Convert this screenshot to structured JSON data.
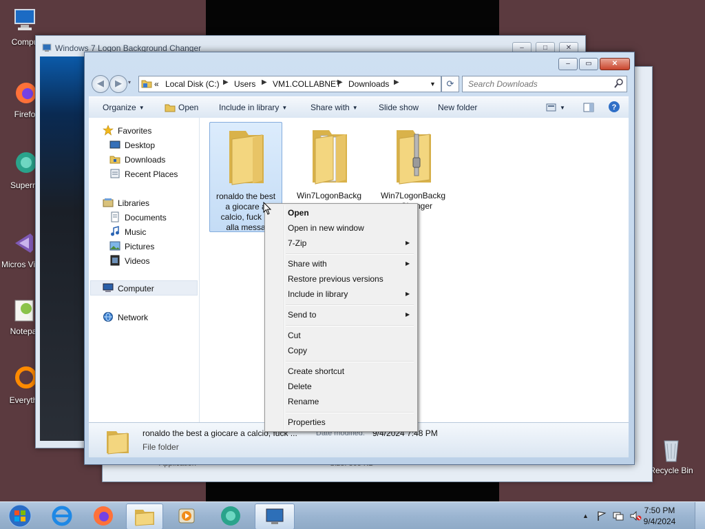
{
  "desktop": {
    "icons": [
      {
        "label": "Compu"
      },
      {
        "label": "Firefo"
      },
      {
        "label": "Superm"
      },
      {
        "label": "Micros Visual St"
      },
      {
        "label": "Notepa"
      },
      {
        "label": "Everyth"
      },
      {
        "label": "Recycle Bin"
      }
    ]
  },
  "bg_window": {
    "title": "Windows 7 Logon Background Changer"
  },
  "bg_window_right": {
    "partial_text_1": "Application",
    "partial_text_2": "Size: 365 KB"
  },
  "explorer": {
    "address": {
      "overflow": "«",
      "crumbs": [
        "Local Disk (C:)",
        "Users",
        "VM1.COLLABNET",
        "Downloads"
      ]
    },
    "search_placeholder": "Search Downloads",
    "toolbar": {
      "organize": "Organize",
      "open": "Open",
      "include_in_library": "Include in library",
      "share_with": "Share with",
      "slide_show": "Slide show",
      "new_folder": "New folder"
    },
    "nav": {
      "favorites": "Favorites",
      "desktop": "Desktop",
      "downloads": "Downloads",
      "recent_places": "Recent Places",
      "libraries": "Libraries",
      "documents": "Documents",
      "music": "Music",
      "pictures": "Pictures",
      "videos": "Videos",
      "computer": "Computer",
      "network": "Network"
    },
    "files": [
      {
        "name_lines": [
          "ronaldo the best",
          "a giocare a",
          "calcio, fuck m",
          "alla messa"
        ],
        "selected": true
      },
      {
        "name_lines": [
          "Win7LogonBackg",
          "...Changer"
        ],
        "selected": false
      },
      {
        "name_lines": [
          "Win7LogonBackg",
          "...Changer"
        ],
        "selected": false
      }
    ],
    "details": {
      "name": "ronaldo the best a giocare a calcio, fuck ...",
      "modified_label": "Date modified:",
      "modified_value": "9/4/2024 7:48 PM",
      "type": "File folder"
    }
  },
  "context_menu": {
    "open": "Open",
    "open_new_window": "Open in new window",
    "seven_zip": "7-Zip",
    "share_with": "Share with",
    "restore_previous": "Restore previous versions",
    "include_in_library": "Include in library",
    "send_to": "Send to",
    "cut": "Cut",
    "copy": "Copy",
    "create_shortcut": "Create shortcut",
    "delete": "Delete",
    "rename": "Rename",
    "properties": "Properties"
  },
  "taskbar": {
    "time": "7:50 PM",
    "date": "9/4/2024",
    "tray_chevron": "▲"
  }
}
